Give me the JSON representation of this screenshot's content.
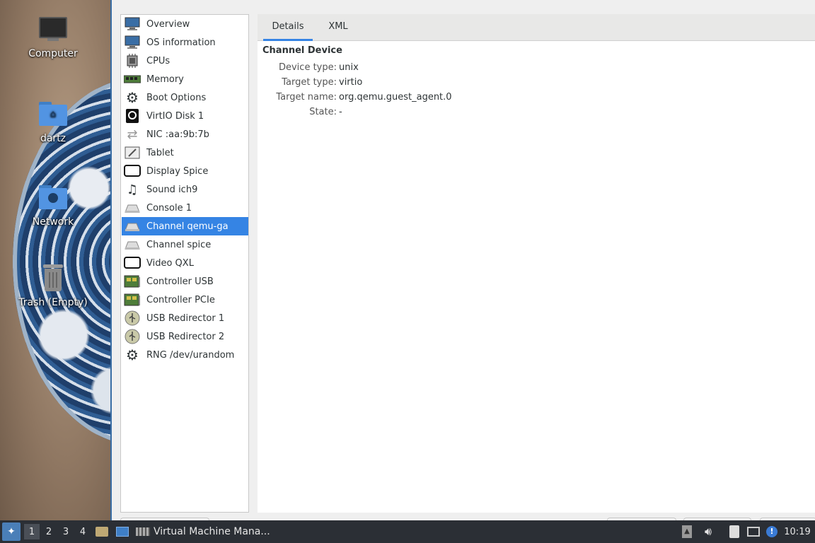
{
  "desktop": {
    "icons": [
      {
        "label": "Computer",
        "icon": "computer-icon"
      },
      {
        "label": "dartz",
        "icon": "home-folder-icon"
      },
      {
        "label": "Network",
        "icon": "network-folder-icon"
      },
      {
        "label": "Trash (Empty)",
        "icon": "trash-icon"
      }
    ]
  },
  "sidebar": {
    "selected_index": 11,
    "items": [
      {
        "label": "Overview",
        "icon": "monitor-icon"
      },
      {
        "label": "OS information",
        "icon": "monitor-icon"
      },
      {
        "label": "CPUs",
        "icon": "cpu-icon"
      },
      {
        "label": "Memory",
        "icon": "memory-icon"
      },
      {
        "label": "Boot Options",
        "icon": "gear-icon"
      },
      {
        "label": "VirtIO Disk 1",
        "icon": "disk-icon"
      },
      {
        "label": "NIC :aa:9b:7b",
        "icon": "network-arrows-icon"
      },
      {
        "label": "Tablet",
        "icon": "tablet-icon"
      },
      {
        "label": "Display Spice",
        "icon": "display-icon"
      },
      {
        "label": "Sound ich9",
        "icon": "sound-icon"
      },
      {
        "label": "Console 1",
        "icon": "serial-icon"
      },
      {
        "label": "Channel qemu-ga",
        "icon": "serial-icon"
      },
      {
        "label": "Channel spice",
        "icon": "serial-icon"
      },
      {
        "label": "Video QXL",
        "icon": "display-icon"
      },
      {
        "label": "Controller USB",
        "icon": "controller-icon"
      },
      {
        "label": "Controller PCIe",
        "icon": "controller-icon"
      },
      {
        "label": "USB Redirector 1",
        "icon": "usb-icon"
      },
      {
        "label": "USB Redirector 2",
        "icon": "usb-icon"
      },
      {
        "label": "RNG /dev/urandom",
        "icon": "gear-icon"
      }
    ]
  },
  "tabs": [
    {
      "label": "Details",
      "active": true
    },
    {
      "label": "XML",
      "active": false
    }
  ],
  "details": {
    "title": "Channel Device",
    "rows": [
      {
        "label": "Device type:",
        "value": "unix"
      },
      {
        "label": "Target type:",
        "value": "virtio"
      },
      {
        "label": "Target name:",
        "value": "org.qemu.guest_agent.0"
      },
      {
        "label": "State:",
        "value": "-"
      }
    ]
  },
  "taskbar": {
    "workspaces": [
      "1",
      "2",
      "3",
      "4"
    ],
    "active_workspace": "1",
    "task_label": "Virtual Machine Mana...",
    "clock": "10:19",
    "tray_icons": [
      "tray-up-arrow-icon",
      "volume-icon",
      "clipboard-icon",
      "network-icon",
      "notification-icon"
    ]
  },
  "colors": {
    "accent": "#3584e4",
    "taskbar": "#2b2f35"
  }
}
